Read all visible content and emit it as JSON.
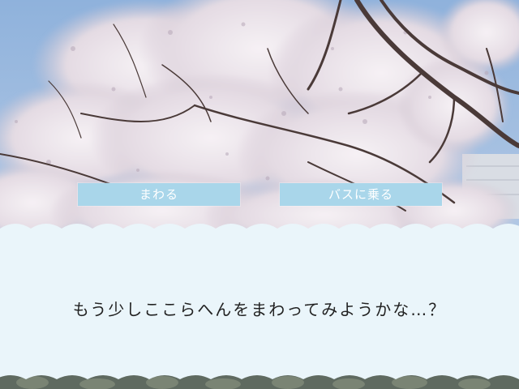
{
  "choices": [
    {
      "label": "まわる"
    },
    {
      "label": "バスに乗る"
    }
  ],
  "message": {
    "text": "もう少しここらへんをまわってみようかな…？"
  },
  "colors": {
    "sky": "#a8c4e4",
    "blossom": "#ece6ee",
    "branch": "#4a3a38",
    "choice_button": "#a9d6ea",
    "message_box": "#eaf5fa"
  },
  "icons": [
    "cherry-blossom-background",
    "scalloped-message-box"
  ]
}
